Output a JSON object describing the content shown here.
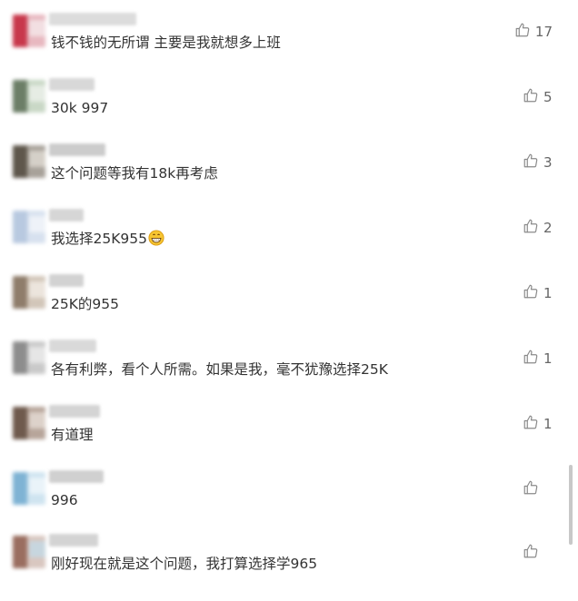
{
  "comments": [
    {
      "text": "钱不钱的无所谓 主要是我就想多上班",
      "likes": "17",
      "avatar_colors": [
        "#e8b8c0",
        "#c8384c",
        "#f2dfe2"
      ],
      "nick_color": "#dcdcdc"
    },
    {
      "text": "30k 997",
      "likes": "5",
      "avatar_colors": [
        "#c9d8c6",
        "#6c7e67",
        "#e6ece4"
      ],
      "nick_color": "#d8d8d8"
    },
    {
      "text": "这个问题等我有18k再考虑",
      "likes": "3",
      "avatar_colors": [
        "#a8a29a",
        "#5f574c",
        "#d5d0c8"
      ],
      "nick_color": "#cccccc"
    },
    {
      "text": "我选择25K955",
      "likes": "2",
      "avatar_colors": [
        "#d7e1ef",
        "#b8c9e0",
        "#eef2f8"
      ],
      "nick_color": "#d6d6d6",
      "emoji": "grin-emoji"
    },
    {
      "text": "25K的955",
      "likes": "1",
      "avatar_colors": [
        "#d2c6b9",
        "#8f7d6b",
        "#ece5dd"
      ],
      "nick_color": "#d2d2d2"
    },
    {
      "text": "各有利弊，看个人所需。如果是我，毫不犹豫选择25K",
      "likes": "1",
      "avatar_colors": [
        "#c9c9c9",
        "#8d8d8d",
        "#e6e6e6"
      ],
      "nick_color": "#d9d9d9"
    },
    {
      "text": "有道理",
      "likes": "1",
      "avatar_colors": [
        "#b7a59a",
        "#6f5a4d",
        "#ddd2ca"
      ],
      "nick_color": "#d4d4d4"
    },
    {
      "text": "996",
      "likes": "",
      "avatar_colors": [
        "#cfe4f0",
        "#7fb3d4",
        "#eaf3f9"
      ],
      "nick_color": "#d0d0d0"
    },
    {
      "text": "刚好现在就是这个问题，我打算选择学965",
      "likes": "",
      "avatar_colors": [
        "#d9c7c0",
        "#9a6e60",
        "#c7d6df"
      ],
      "nick_color": "#d3d3d3"
    }
  ],
  "icons": {
    "like": "thumbs-up-icon"
  }
}
